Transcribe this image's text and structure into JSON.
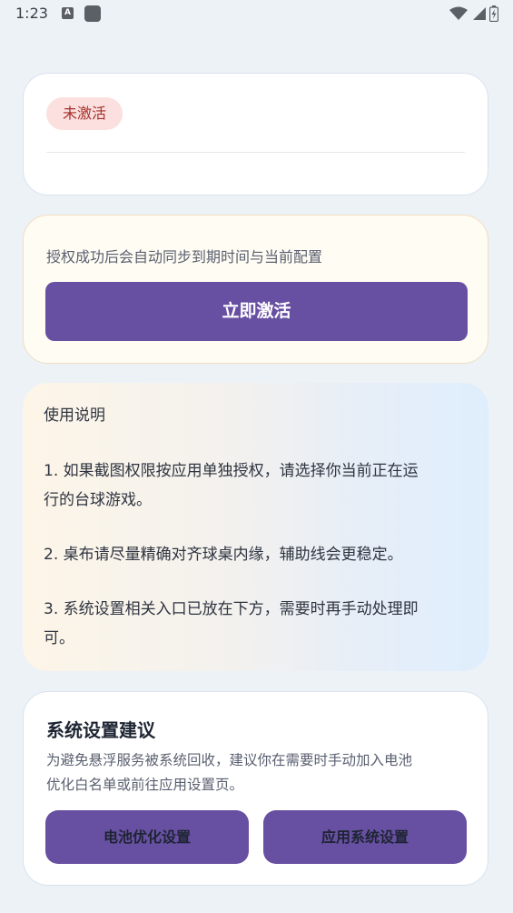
{
  "status_bar": {
    "time": "1:23",
    "notification_icon": "A",
    "icons": [
      "wifi-icon",
      "signal-icon",
      "battery-charging-icon"
    ]
  },
  "status_card": {
    "badge_label": "未激活",
    "badge_color": "#a4302b"
  },
  "activate_card": {
    "hint": "授权成功后会自动同步到期时间与当前配置",
    "button_label": "立即激活",
    "accent": "#674fa1"
  },
  "guide_card": {
    "title": "使用说明",
    "items": [
      "1. 如果截图权限按应用单独授权，请选择你当前正在运",
      "行的台球游戏。",
      "2. 桌布请尽量精确对齐球桌内缘，辅助线会更稳定。",
      "3. 系统设置相关入口已放在下方，需要时再手动处理即",
      "可。"
    ]
  },
  "system_card": {
    "title": "系统设置建议",
    "desc_line1": "为避免悬浮服务被系统回收，建议你在需要时手动加入电池",
    "desc_line2": "优化白名单或前往应用设置页。",
    "battery_button": "电池优化设置",
    "app_settings_button": "应用系统设置"
  }
}
